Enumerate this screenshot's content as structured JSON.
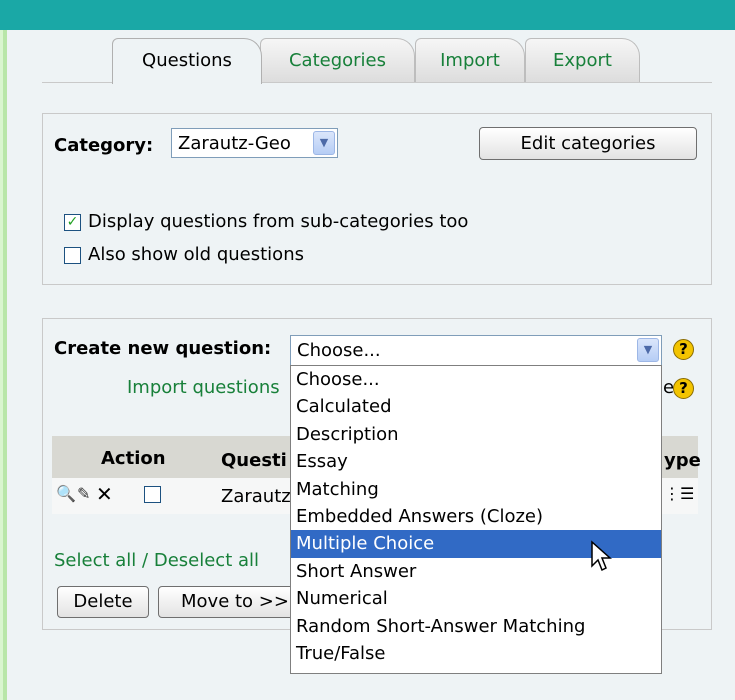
{
  "tabs": [
    {
      "label": "Questions",
      "active": true
    },
    {
      "label": "Categories",
      "active": false
    },
    {
      "label": "Import",
      "active": false
    },
    {
      "label": "Export",
      "active": false
    }
  ],
  "category_panel": {
    "category_label": "Category:",
    "category_value": "Zarautz-Geo",
    "edit_categories_label": "Edit categories",
    "display_subcategories_label": "Display questions from sub-categories too",
    "display_subcategories_checked": true,
    "show_old_label": "Also show old questions",
    "show_old_checked": false
  },
  "question_panel": {
    "create_label": "Create new question:",
    "create_value": "Choose...",
    "import_link_visible": "Import questions",
    "table_headers": {
      "action": "Action",
      "question_visible": "Questi",
      "type_visible": "ype"
    },
    "row": {
      "name_visible": "Zarautz"
    },
    "select_all": "Select all",
    "deselect_all": "Deselect all",
    "separator": "/",
    "delete_label": "Delete",
    "move_to_label": "Move to >>"
  },
  "dropdown_options": [
    {
      "label": "Choose..."
    },
    {
      "label": "Calculated"
    },
    {
      "label": "Description"
    },
    {
      "label": "Essay"
    },
    {
      "label": "Matching"
    },
    {
      "label": "Embedded Answers (Cloze)"
    },
    {
      "label": "Multiple Choice",
      "highlighted": true
    },
    {
      "label": "Short Answer"
    },
    {
      "label": "Numerical"
    },
    {
      "label": "Random Short-Answer Matching"
    },
    {
      "label": "True/False"
    }
  ],
  "colors": {
    "topbar": "#1aa8a6",
    "link": "#18803a",
    "highlight": "#316ac5",
    "page_bg": "#d9f5cf"
  },
  "icons": {
    "preview": "magnifier-icon",
    "edit": "pencil-icon",
    "delete": "x-icon",
    "help": "help-icon",
    "type": "multichoice-type-icon"
  }
}
